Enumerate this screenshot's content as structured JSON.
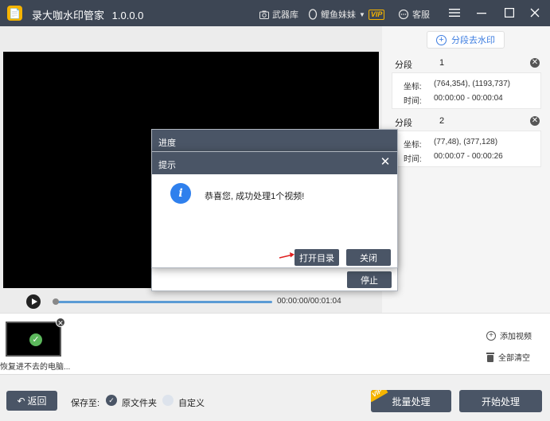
{
  "titlebar": {
    "app_name": "录大咖水印管家",
    "version": "1.0.0.0",
    "arsenal_label": "武器库",
    "username": "鲤鱼妹妹",
    "vip_label": "VIP",
    "service_label": "客服"
  },
  "player": {
    "time_display": "00:00:00/00:01:04"
  },
  "segments_panel": {
    "add_segment_label": "分段去水印",
    "segments": [
      {
        "header": "分段",
        "index": "1",
        "coord_label": "坐标:",
        "coord_value": "(764,354), (1193,737)",
        "time_label": "时间:",
        "time_value": "00:00:00 - 00:00:04"
      },
      {
        "header": "分段",
        "index": "2",
        "coord_label": "坐标:",
        "coord_value": "(77,48), (377,128)",
        "time_label": "时间:",
        "time_value": "00:00:07 - 00:00:26"
      }
    ]
  },
  "thumbnails": {
    "items": [
      {
        "name": "恢复进不去的电脑..."
      }
    ],
    "add_video_label": "添加视频",
    "clear_all_label": "全部清空"
  },
  "bottom_bar": {
    "back_label": "返回",
    "save_to_label": "保存至:",
    "option_original": "原文件夹",
    "option_custom": "自定义",
    "batch_label": "批量处理",
    "batch_vip": "VIP",
    "start_label": "开始处理"
  },
  "progress_dialog": {
    "title": "进度",
    "stop_label": "停止"
  },
  "prompt_dialog": {
    "title": "提示",
    "close_glyph": "✕",
    "message": "恭喜您, 成功处理1个视频!",
    "open_dir_label": "打开目录",
    "close_label": "关闭"
  },
  "colors": {
    "titlebar_bg": "#3d4654",
    "button_bg": "#4a5566",
    "accent_blue": "#2f80ed",
    "vip_gold": "#f5b400",
    "arrow_red": "#e02020"
  }
}
